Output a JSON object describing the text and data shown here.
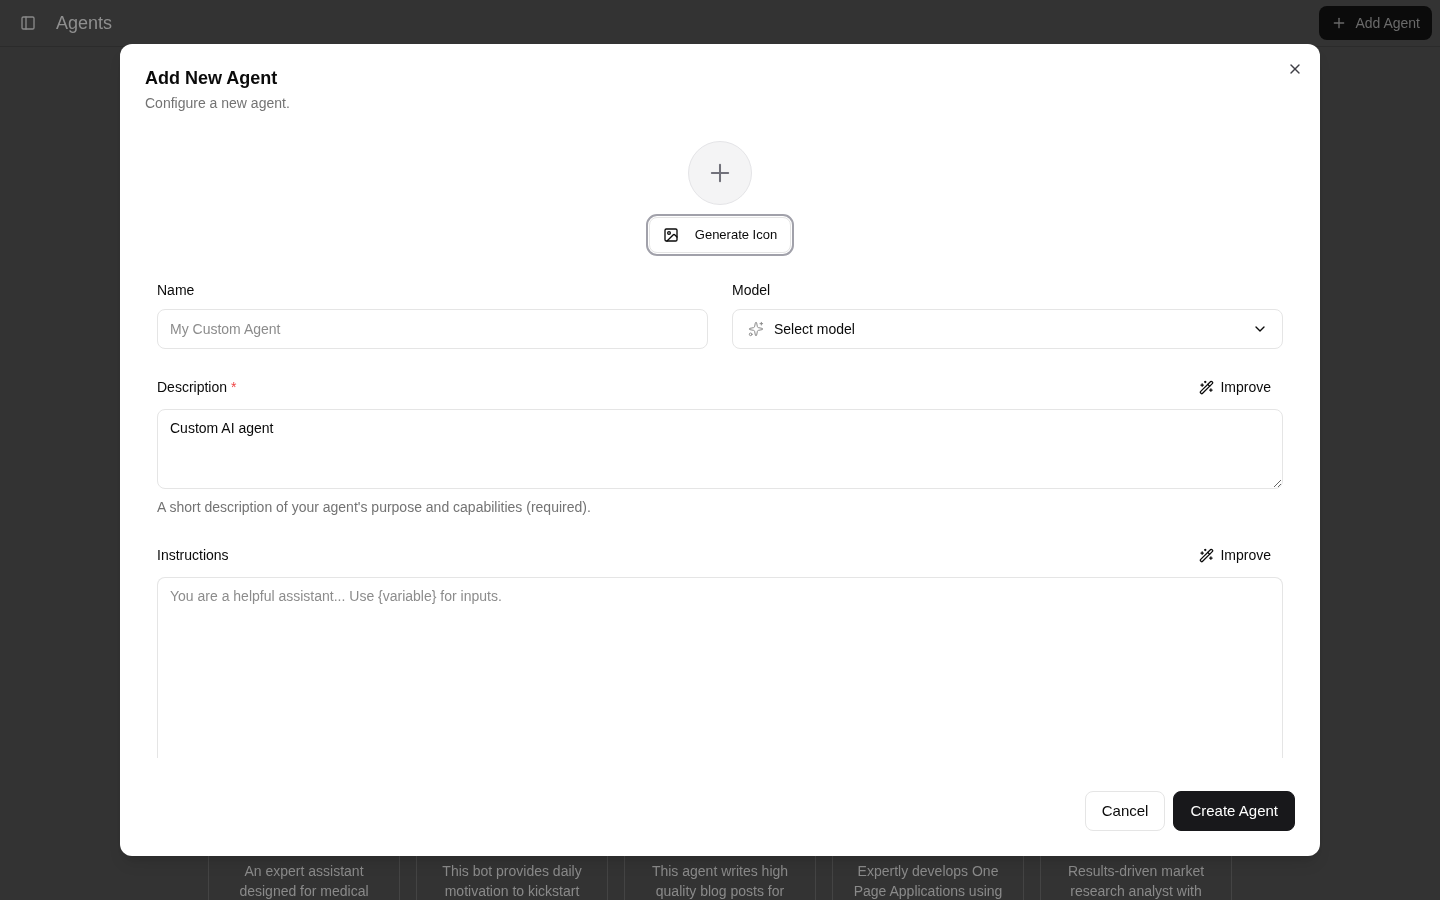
{
  "page": {
    "header": {
      "title": "Agents",
      "add_button": "Add Agent"
    },
    "agent_cards": [
      {
        "description": "An expert assistant designed for medical"
      },
      {
        "description": "This bot provides daily motivation to kickstart"
      },
      {
        "description": "This agent writes high quality blog posts for"
      },
      {
        "description": "Expertly develops One Page Applications using"
      },
      {
        "description": "Results-driven market research analyst with"
      }
    ]
  },
  "dialog": {
    "title": "Add New Agent",
    "subtitle": "Configure a new agent.",
    "icon_button": {
      "label": "Generate Icon",
      "focused": true
    },
    "name": {
      "label": "Name",
      "placeholder": "My Custom Agent"
    },
    "model": {
      "label": "Model",
      "value": "Select model"
    },
    "description": {
      "label": "Description",
      "required_mark": "*",
      "improve_button": "Improve",
      "value": "Custom AI agent",
      "help": "A short description of your agent's purpose and capabilities (required)."
    },
    "instructions": {
      "label": "Instructions",
      "improve_button": "Improve",
      "placeholder": "You are a helpful assistant... Use {variable} for inputs."
    },
    "buttons": [
      {
        "label": "Cancel",
        "kind": "secondary"
      },
      {
        "label": "Create Agent",
        "kind": "primary"
      }
    ]
  }
}
